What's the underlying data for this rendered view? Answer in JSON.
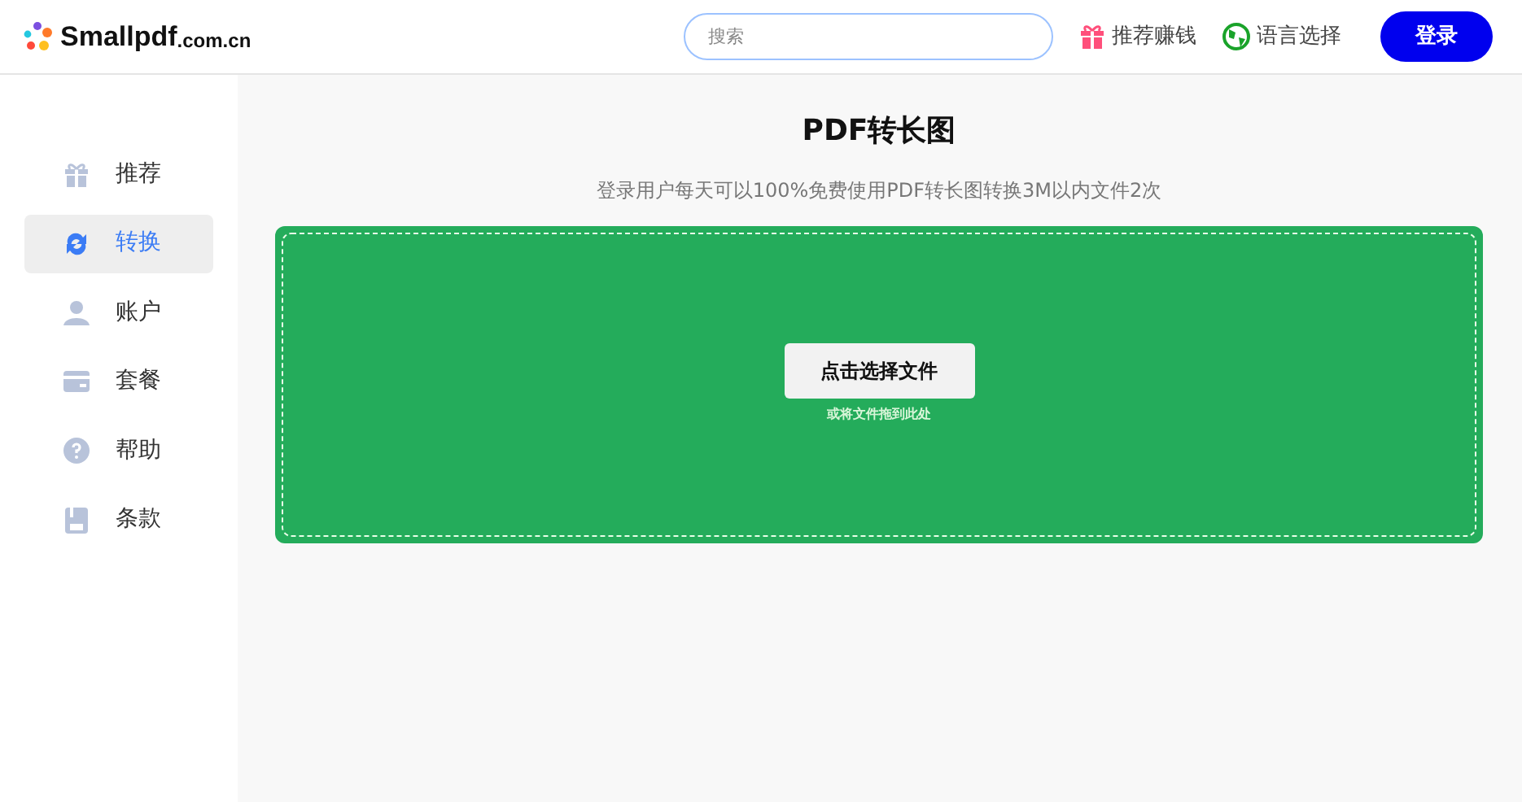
{
  "header": {
    "logo": {
      "name": "Smallpdf",
      "domain": ".com.cn"
    },
    "search": {
      "placeholder": "搜索"
    },
    "links": [
      {
        "kind": "gift",
        "label": "推荐赚钱"
      },
      {
        "kind": "globe",
        "label": "语言选择"
      }
    ],
    "login": "登录"
  },
  "sidebar": {
    "items": [
      {
        "kind": "gift",
        "label": "推荐",
        "selected": false
      },
      {
        "kind": "convert",
        "label": "转换",
        "selected": true
      },
      {
        "kind": "user",
        "label": "账户",
        "selected": false
      },
      {
        "kind": "card",
        "label": "套餐",
        "selected": false
      },
      {
        "kind": "help",
        "label": "帮助",
        "selected": false
      },
      {
        "kind": "doc",
        "label": "条款",
        "selected": false
      }
    ]
  },
  "main": {
    "title": "PDF转长图",
    "subtitle": "登录用户每天可以100%免费使用PDF转长图转换3M以内文件2次",
    "dropzone": {
      "button": "点击选择文件",
      "hint": "或将文件拖到此处"
    }
  }
}
